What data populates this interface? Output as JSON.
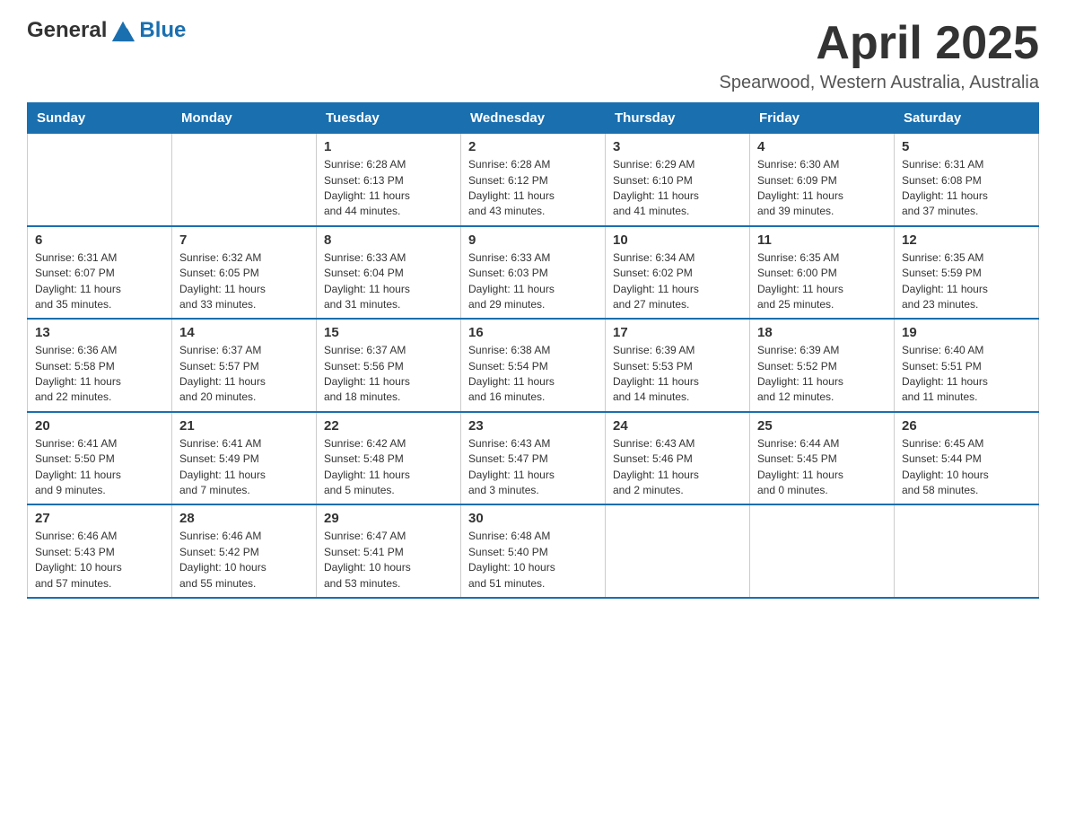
{
  "header": {
    "logo": {
      "general": "General",
      "blue": "Blue"
    },
    "title": "April 2025",
    "location": "Spearwood, Western Australia, Australia"
  },
  "days_of_week": [
    "Sunday",
    "Monday",
    "Tuesday",
    "Wednesday",
    "Thursday",
    "Friday",
    "Saturday"
  ],
  "weeks": [
    [
      {
        "day": "",
        "info": ""
      },
      {
        "day": "",
        "info": ""
      },
      {
        "day": "1",
        "info": "Sunrise: 6:28 AM\nSunset: 6:13 PM\nDaylight: 11 hours\nand 44 minutes."
      },
      {
        "day": "2",
        "info": "Sunrise: 6:28 AM\nSunset: 6:12 PM\nDaylight: 11 hours\nand 43 minutes."
      },
      {
        "day": "3",
        "info": "Sunrise: 6:29 AM\nSunset: 6:10 PM\nDaylight: 11 hours\nand 41 minutes."
      },
      {
        "day": "4",
        "info": "Sunrise: 6:30 AM\nSunset: 6:09 PM\nDaylight: 11 hours\nand 39 minutes."
      },
      {
        "day": "5",
        "info": "Sunrise: 6:31 AM\nSunset: 6:08 PM\nDaylight: 11 hours\nand 37 minutes."
      }
    ],
    [
      {
        "day": "6",
        "info": "Sunrise: 6:31 AM\nSunset: 6:07 PM\nDaylight: 11 hours\nand 35 minutes."
      },
      {
        "day": "7",
        "info": "Sunrise: 6:32 AM\nSunset: 6:05 PM\nDaylight: 11 hours\nand 33 minutes."
      },
      {
        "day": "8",
        "info": "Sunrise: 6:33 AM\nSunset: 6:04 PM\nDaylight: 11 hours\nand 31 minutes."
      },
      {
        "day": "9",
        "info": "Sunrise: 6:33 AM\nSunset: 6:03 PM\nDaylight: 11 hours\nand 29 minutes."
      },
      {
        "day": "10",
        "info": "Sunrise: 6:34 AM\nSunset: 6:02 PM\nDaylight: 11 hours\nand 27 minutes."
      },
      {
        "day": "11",
        "info": "Sunrise: 6:35 AM\nSunset: 6:00 PM\nDaylight: 11 hours\nand 25 minutes."
      },
      {
        "day": "12",
        "info": "Sunrise: 6:35 AM\nSunset: 5:59 PM\nDaylight: 11 hours\nand 23 minutes."
      }
    ],
    [
      {
        "day": "13",
        "info": "Sunrise: 6:36 AM\nSunset: 5:58 PM\nDaylight: 11 hours\nand 22 minutes."
      },
      {
        "day": "14",
        "info": "Sunrise: 6:37 AM\nSunset: 5:57 PM\nDaylight: 11 hours\nand 20 minutes."
      },
      {
        "day": "15",
        "info": "Sunrise: 6:37 AM\nSunset: 5:56 PM\nDaylight: 11 hours\nand 18 minutes."
      },
      {
        "day": "16",
        "info": "Sunrise: 6:38 AM\nSunset: 5:54 PM\nDaylight: 11 hours\nand 16 minutes."
      },
      {
        "day": "17",
        "info": "Sunrise: 6:39 AM\nSunset: 5:53 PM\nDaylight: 11 hours\nand 14 minutes."
      },
      {
        "day": "18",
        "info": "Sunrise: 6:39 AM\nSunset: 5:52 PM\nDaylight: 11 hours\nand 12 minutes."
      },
      {
        "day": "19",
        "info": "Sunrise: 6:40 AM\nSunset: 5:51 PM\nDaylight: 11 hours\nand 11 minutes."
      }
    ],
    [
      {
        "day": "20",
        "info": "Sunrise: 6:41 AM\nSunset: 5:50 PM\nDaylight: 11 hours\nand 9 minutes."
      },
      {
        "day": "21",
        "info": "Sunrise: 6:41 AM\nSunset: 5:49 PM\nDaylight: 11 hours\nand 7 minutes."
      },
      {
        "day": "22",
        "info": "Sunrise: 6:42 AM\nSunset: 5:48 PM\nDaylight: 11 hours\nand 5 minutes."
      },
      {
        "day": "23",
        "info": "Sunrise: 6:43 AM\nSunset: 5:47 PM\nDaylight: 11 hours\nand 3 minutes."
      },
      {
        "day": "24",
        "info": "Sunrise: 6:43 AM\nSunset: 5:46 PM\nDaylight: 11 hours\nand 2 minutes."
      },
      {
        "day": "25",
        "info": "Sunrise: 6:44 AM\nSunset: 5:45 PM\nDaylight: 11 hours\nand 0 minutes."
      },
      {
        "day": "26",
        "info": "Sunrise: 6:45 AM\nSunset: 5:44 PM\nDaylight: 10 hours\nand 58 minutes."
      }
    ],
    [
      {
        "day": "27",
        "info": "Sunrise: 6:46 AM\nSunset: 5:43 PM\nDaylight: 10 hours\nand 57 minutes."
      },
      {
        "day": "28",
        "info": "Sunrise: 6:46 AM\nSunset: 5:42 PM\nDaylight: 10 hours\nand 55 minutes."
      },
      {
        "day": "29",
        "info": "Sunrise: 6:47 AM\nSunset: 5:41 PM\nDaylight: 10 hours\nand 53 minutes."
      },
      {
        "day": "30",
        "info": "Sunrise: 6:48 AM\nSunset: 5:40 PM\nDaylight: 10 hours\nand 51 minutes."
      },
      {
        "day": "",
        "info": ""
      },
      {
        "day": "",
        "info": ""
      },
      {
        "day": "",
        "info": ""
      }
    ]
  ]
}
